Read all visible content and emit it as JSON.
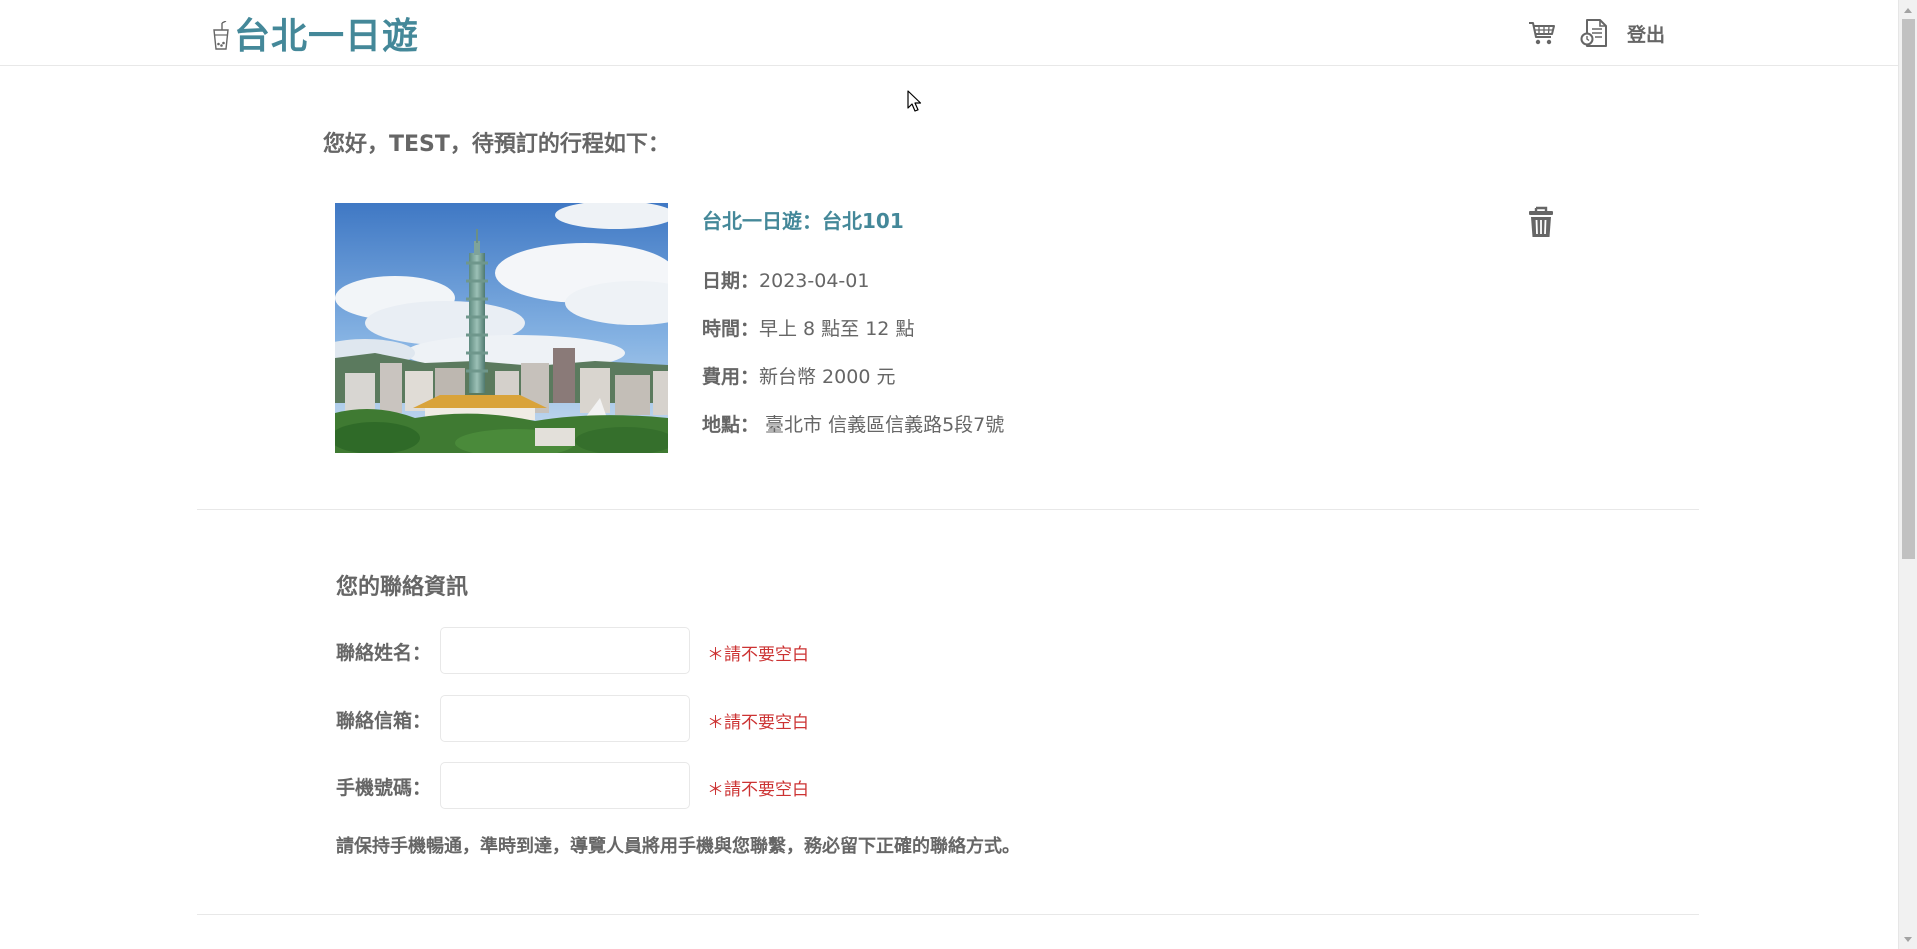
{
  "header": {
    "logo_text": "台北一日遊",
    "logout_label": "登出"
  },
  "greeting": "您好，TEST，待預訂的行程如下：",
  "booking": {
    "title": "台北一日遊：台北101",
    "date_label": "日期：",
    "date_value": "2023-04-01",
    "time_label": "時間：",
    "time_value": "早上 8 點至 12 點",
    "fee_label": "費用：",
    "fee_value": "新台幣 2000 元",
    "address_label": "地點：",
    "address_value": " 臺北市 信義區信義路5段7號"
  },
  "contact": {
    "title": "您的聯絡資訊",
    "name_label": "聯絡姓名：",
    "email_label": "聯絡信箱：",
    "phone_label": "手機號碼：",
    "name_value": "",
    "email_value": "",
    "phone_value": "",
    "name_warning": "＊請不要空白",
    "email_warning": "＊請不要空白",
    "phone_warning": "＊請不要空白",
    "notice": "請保持手機暢通，準時到達，導覽人員將用手機與您聯繫，務必留下正確的聯絡方式。"
  },
  "icons": {
    "cart": "cart-icon",
    "booking": "booking-document-icon",
    "trash": "trash-icon",
    "logo": "drink-cup-icon"
  },
  "colors": {
    "brand": "#448899",
    "text": "#666666",
    "warning": "#cc3333",
    "divider": "#e8e8e8"
  }
}
